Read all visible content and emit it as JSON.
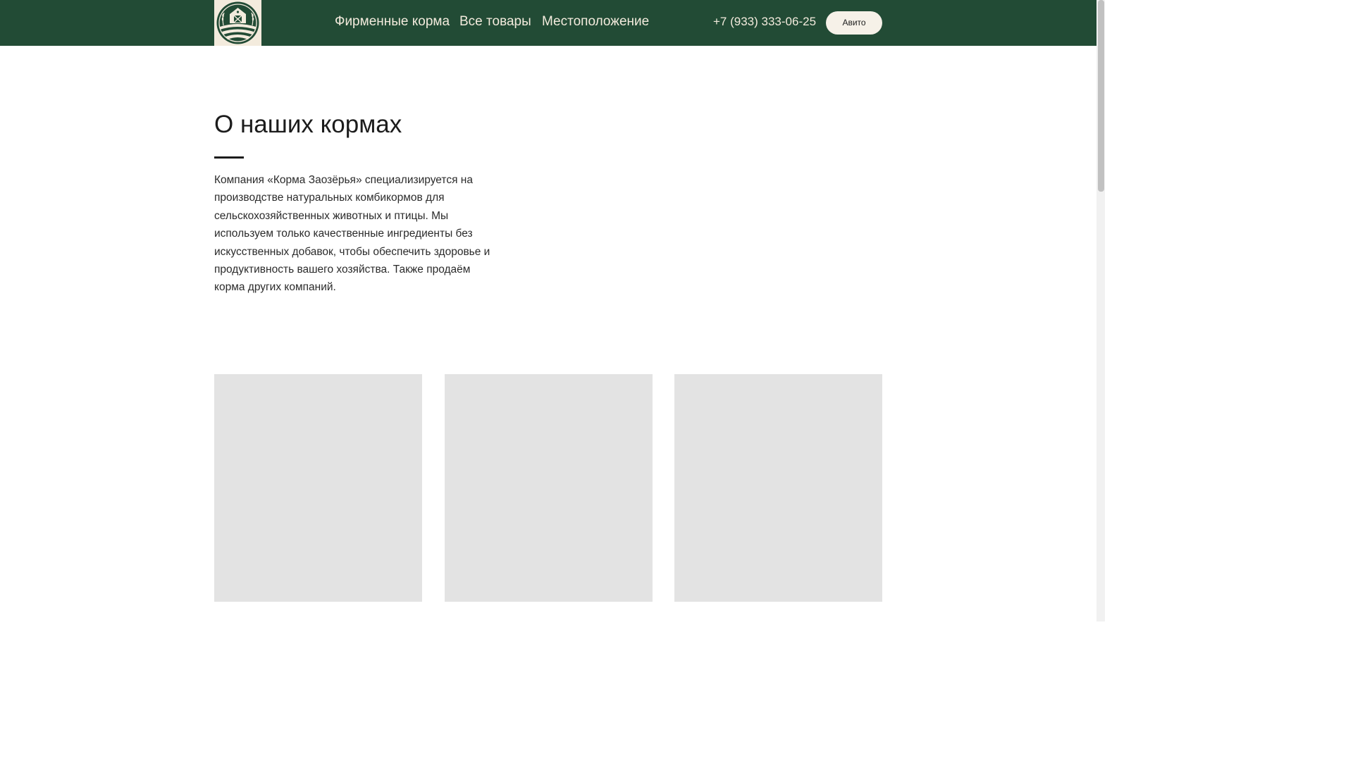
{
  "header": {
    "logo_icon": "barn-field-logo-icon",
    "nav": [
      {
        "label": "Фирменные корма"
      },
      {
        "label": "Все товары"
      },
      {
        "label": "Местоположение"
      }
    ],
    "phone": "+7 (933) 333-06-25",
    "avito_label": "Авито"
  },
  "about": {
    "title": "О наших кормах",
    "text": "Компания «Корма Заозёрья» специализируется на производстве натуральных комбикормов для сельскохозяйственных животных и птицы. Мы используем только качественные ингредиенты без искусственных добавок, чтобы обеспечить здоровье и продуктивность вашего хозяйства. Также продаём корма других компаний."
  },
  "colors": {
    "header_bg": "#224b35",
    "header_text": "#f3ebdd",
    "button_bg": "#f6f1e8",
    "card_placeholder": "#e3e3e3"
  }
}
